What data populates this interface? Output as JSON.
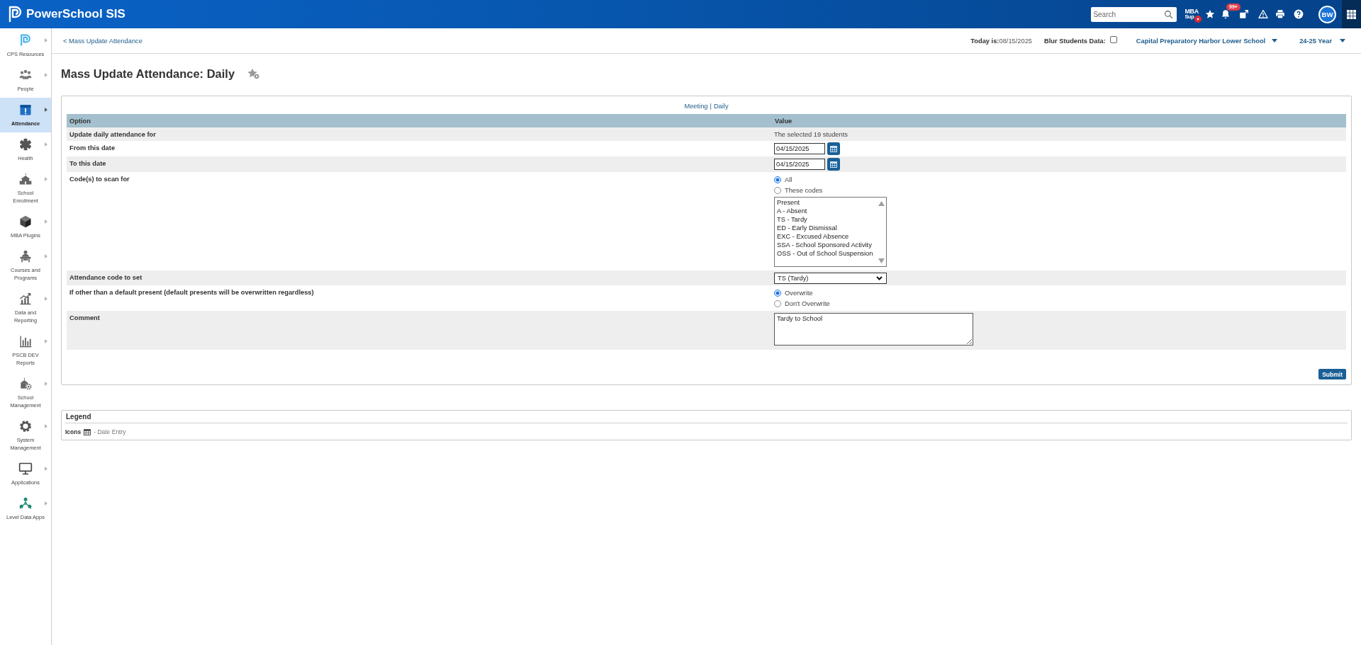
{
  "top_bar": {
    "app_name": "PowerSchool SIS",
    "search": {
      "placeholder": "Search"
    },
    "mba_logo": {
      "line_1": "MBA",
      "line_2": "Sup"
    },
    "alerts_badge": "99+",
    "avatar": "BW"
  },
  "sidebar": {
    "items": [
      {
        "label": "CPS Resources",
        "selected": false
      },
      {
        "label": "People",
        "selected": false
      },
      {
        "label": "Attendance",
        "selected": true
      },
      {
        "label": "Health",
        "selected": false
      },
      {
        "label": "School Enrollment",
        "selected": false
      },
      {
        "label": "MBA Plugins",
        "selected": false
      },
      {
        "label": "Courses and Programs",
        "selected": false
      },
      {
        "label": "Data and Reporting",
        "selected": false
      },
      {
        "label": "PSCB DEV Reports",
        "selected": false
      },
      {
        "label": "School Management",
        "selected": false
      },
      {
        "label": "System Management",
        "selected": false
      },
      {
        "label": "Applications",
        "selected": false
      },
      {
        "label": "Level Data Apps",
        "selected": false
      }
    ]
  },
  "header": {
    "back_link": "< Mass Update Attendance",
    "today": "**Today is:**08/15/2025",
    "blur_students": {
      "label": "Blur Students Data:",
      "checked": false
    },
    "school": "Capital Preparatory Harbor Lower School",
    "year": "24-25 Year"
  },
  "page_title": "Mass Update Attendance: Daily",
  "form": {
    "mode_links": [
      "Meeting",
      "Daily"
    ],
    "mode_separator": "|",
    "columns": [
      "Option",
      "Value"
    ],
    "rows": [
      {
        "kind": "text",
        "option": "Update daily attendance for",
        "value": "The selected 19 students"
      },
      {
        "kind": "date",
        "option": "From this date",
        "value": "04/15/2025"
      },
      {
        "kind": "date",
        "option": "To this date",
        "value": "04/15/2025"
      },
      {
        "kind": "codes",
        "option": "Code(s) to scan for",
        "choices": [
          {
            "label": "All",
            "selected": true
          },
          {
            "label": "These codes",
            "selected": false
          }
        ],
        "codes": [
          "Present",
          "A - Absent",
          "TS - Tardy",
          "ED - Early Dismissal",
          "EXC - Excused Absence",
          "SSA - School Sponsored Activity",
          "OSS - Out of School Suspension"
        ]
      },
      {
        "kind": "select",
        "option": "Attendance code to set",
        "value": "TS (Tardy)"
      },
      {
        "kind": "radio",
        "option": "If other than a default present (default presents will be overwritten regardless)",
        "choices": [
          {
            "label": "Overwrite",
            "selected": true
          },
          {
            "label": "Don't Overwrite",
            "selected": false
          }
        ]
      },
      {
        "kind": "textarea",
        "option": "Comment",
        "value": "Tardy to School"
      }
    ],
    "submit": "Submit"
  },
  "legend": {
    "title": "Legend",
    "label": "Icons",
    "entry": "- Date Entry"
  }
}
